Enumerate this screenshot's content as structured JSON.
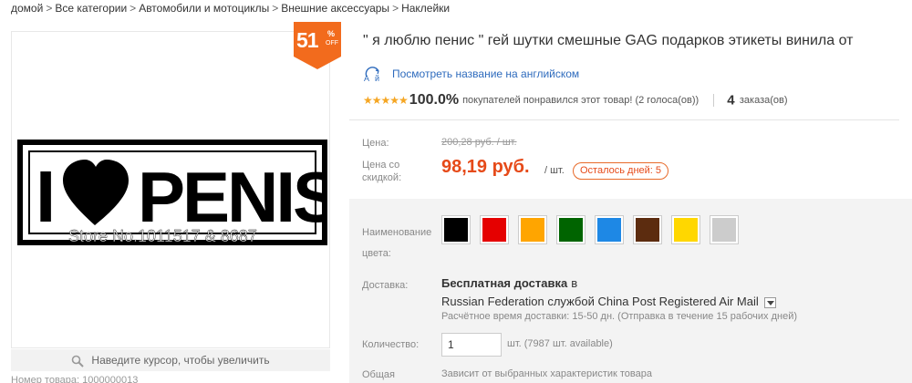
{
  "breadcrumb": {
    "items": [
      "домой",
      "Все категории",
      "Автомобили и мотоциклы",
      "Внешние аксессуары",
      "Наклейки"
    ],
    "separator": ">"
  },
  "gallery": {
    "product_image_text": "I ♥ PENIS",
    "watermark_text": "Store No.1011517 & 8687",
    "zoom_hint": "Наведите курсор, чтобы увеличить",
    "bottom_cut_text": "Номер товара: 1000000013"
  },
  "discount_badge": {
    "value": "51",
    "percent": "%",
    "off": "OFF",
    "color": "#f26b1d"
  },
  "product": {
    "title": "\" я люблю пенис \" гей шутки смешные GAG подарков этикеты винила от",
    "translate_link": "Посмотреть название на английском"
  },
  "rating": {
    "stars": "★★★★★",
    "percent": "100.0%",
    "text": "покупателей понравился этот товар! (2 голоса(ов))",
    "orders_count": "4",
    "orders_label": "заказа(ов)"
  },
  "price": {
    "label": "Цена:",
    "old_value": "200,28 руб. / шт.",
    "discount_label": "Цена со скидкой:",
    "new_value": "98,19 руб.",
    "unit": "/ шт.",
    "countdown": "Осталось дней: 5",
    "accent_color": "#e64a19"
  },
  "color_option": {
    "label": "Наименование цвета:",
    "swatches": [
      {
        "name": "black",
        "color": "#000000"
      },
      {
        "name": "red",
        "color": "#e50000"
      },
      {
        "name": "orange",
        "color": "#ffa500"
      },
      {
        "name": "green",
        "color": "#006400"
      },
      {
        "name": "blue",
        "color": "#1e88e5"
      },
      {
        "name": "brown",
        "color": "#5c2c0f"
      },
      {
        "name": "yellow",
        "color": "#ffd700"
      },
      {
        "name": "silver",
        "color": "#cccccc"
      }
    ]
  },
  "shipping": {
    "label": "Доставка:",
    "title": "Бесплатная доставка",
    "in_word": "в",
    "method": "Russian Federation службой China Post Registered Air Mail",
    "eta": "Расчётное время доставки: 15-50 дн. (Отправка в течение 15 рабочих дней)"
  },
  "quantity": {
    "label": "Количество:",
    "value": "1",
    "available": "шт. (7987 шт. available)"
  },
  "total": {
    "label": "Общая",
    "note": "Зависит от выбранных характеристик товара"
  }
}
